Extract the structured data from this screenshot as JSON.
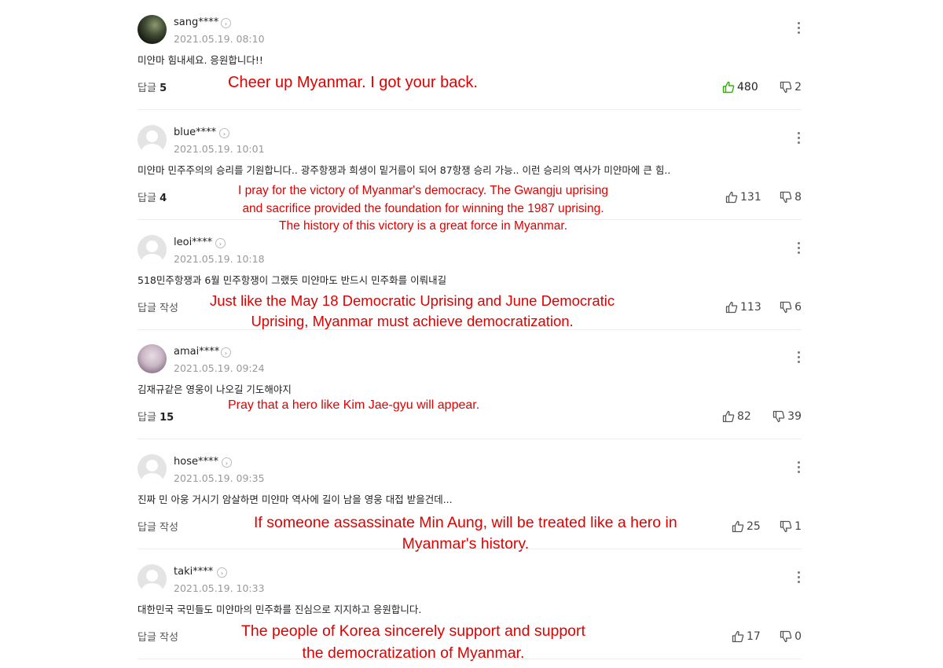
{
  "comments": [
    {
      "username": "sang****",
      "date": "2021.05.19. 08:10",
      "text": "미얀마 힘내세요. 응원합니다!!",
      "reply_label": "답글",
      "reply_count": "5",
      "likes": "480",
      "dislikes": "2",
      "translation_lines": [
        "Cheer up Myanmar. I got your back."
      ]
    },
    {
      "username": "blue****",
      "date": "2021.05.19. 10:01",
      "text": "미얀마 민주주의의 승리를 기원합니다.. 광주항쟁과 희생이 밑거름이 되어 87항쟁 승리 가능.. 이런 승리의 역사가 미얀마에 큰 힘..",
      "reply_label": "답글",
      "reply_count": "4",
      "likes": "131",
      "dislikes": "8",
      "translation_lines": [
        "I pray for the victory of Myanmar's democracy. The Gwangju uprising",
        "and sacrifice provided the foundation for winning the 1987 uprising.",
        "The history of this victory is a great force in Myanmar."
      ]
    },
    {
      "username": "leoi****",
      "date": "2021.05.19. 10:18",
      "text": "518민주항쟁과 6월 민주항쟁이 그랬듯 미얀마도 반드시 민주화를 이뤄내길",
      "reply_label": "답글 작성",
      "reply_count": "",
      "likes": "113",
      "dislikes": "6",
      "translation_lines": [
        "Just like the May 18 Democratic Uprising and June Democratic",
        "Uprising, Myanmar must achieve democratization."
      ]
    },
    {
      "username": "amai****",
      "date": "2021.05.19. 09:24",
      "text": "김재규같은 영웅이 나오길 기도해야지",
      "reply_label": "답글",
      "reply_count": "15",
      "likes": "82",
      "dislikes": "39",
      "translation_lines": [
        "Pray that a hero like Kim Jae-gyu will appear."
      ]
    },
    {
      "username": "hose****",
      "date": "2021.05.19. 09:35",
      "text": "진짜 민 아웅 거시기 암살하면 미얀마 역사에 길이 남을 영웅 대접 받을건데...",
      "reply_label": "답글 작성",
      "reply_count": "",
      "likes": "25",
      "dislikes": "1",
      "translation_lines": [
        "If someone assassinate Min Aung, will be treated like a hero in",
        "Myanmar's history."
      ]
    },
    {
      "username": "taki****",
      "date": "2021.05.19. 10:33",
      "text": "대한민국 국민들도 미얀마의 민주화를 진심으로 지지하고 응원합니다.",
      "reply_label": "답글 작성",
      "reply_count": "",
      "likes": "17",
      "dislikes": "0",
      "translation_lines": [
        "The people of Korea sincerely support and support",
        "the democratization of Myanmar."
      ]
    }
  ],
  "icons": {
    "profile": "chevron-right-icon",
    "more": "more-vertical-icon",
    "like": "thumbs-up-icon",
    "dislike": "thumbs-down-icon"
  },
  "colors": {
    "translation": "#e10000",
    "liked": "#2db400"
  }
}
